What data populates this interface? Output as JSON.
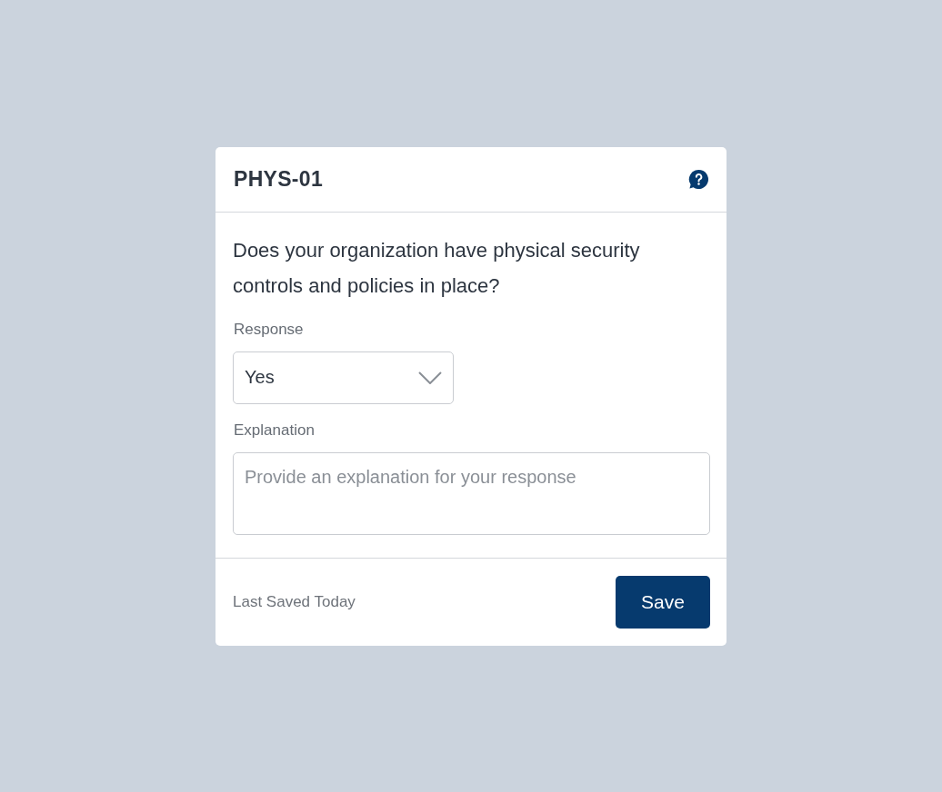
{
  "card": {
    "title": "PHYS-01",
    "question": "Does your organization have physical security controls and policies in place?",
    "response": {
      "label": "Response",
      "value": "Yes"
    },
    "explanation": {
      "label": "Explanation",
      "placeholder": "Provide an explanation for your response"
    },
    "footer": {
      "status": "Last Saved Today",
      "button": "Save"
    }
  }
}
